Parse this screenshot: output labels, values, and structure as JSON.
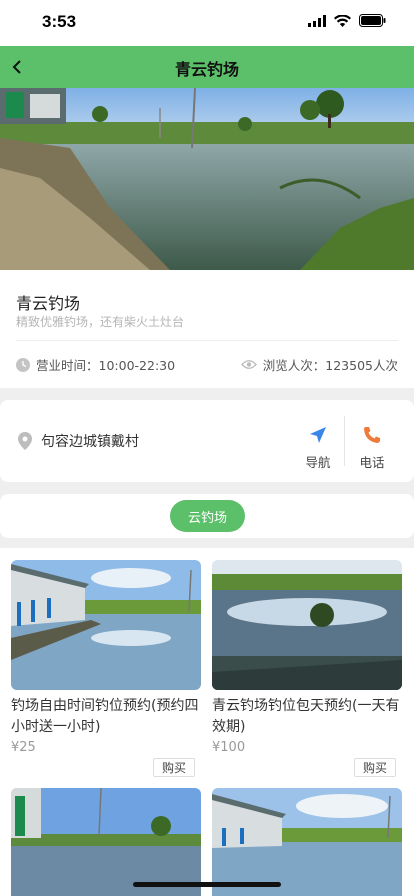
{
  "status": {
    "time": "3:53"
  },
  "header": {
    "title": "青云钓场",
    "back_icon": "chevron-left-icon"
  },
  "shop": {
    "name": "青云钓场",
    "description": "精致优雅钓场，还有柴火土灶台",
    "hours": "营业时间：10:00-22:30",
    "views": "浏览人次：123505人次"
  },
  "address": {
    "text": "句容边城镇戴村",
    "navigate_label": "导航",
    "call_label": "电话"
  },
  "tabs": [
    {
      "label": "云钓场",
      "active": true
    }
  ],
  "products": [
    {
      "title": "钓场自由时间钓位预约(预约四小时送一小时)",
      "price": "¥25",
      "buy_label": "购买"
    },
    {
      "title": "青云钓场钓位包天预约(一天有效期)",
      "price": "¥100",
      "buy_label": "购买"
    }
  ],
  "colors": {
    "brand_green": "#5cc06a",
    "nav_blue": "#3a86e8",
    "phone_orange": "#f07a3a"
  }
}
